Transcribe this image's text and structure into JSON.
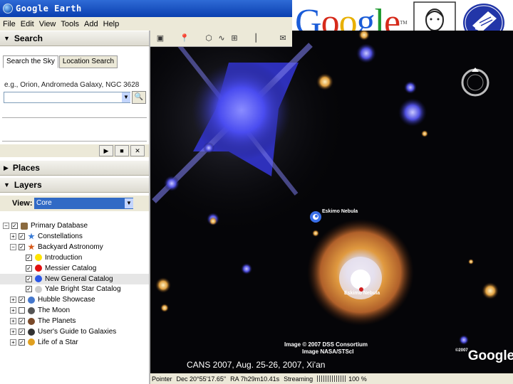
{
  "window": {
    "title": "Google Earth"
  },
  "menu": [
    "File",
    "Edit",
    "View",
    "Tools",
    "Add",
    "Help"
  ],
  "logos": {
    "google": "Google",
    "tm": "TM"
  },
  "search_panel": {
    "header": "Search",
    "tabs": [
      "Search the Sky",
      "Location Search"
    ],
    "hint": "e.g., Orion, Andromeda Galaxy, NGC 3628",
    "input_value": "",
    "controls": [
      "▶",
      "■",
      "✕"
    ]
  },
  "places_panel": {
    "header": "Places"
  },
  "layers_panel": {
    "header": "Layers",
    "view_label": "View:",
    "view_value": "Core",
    "tree": [
      {
        "label": "Primary Database",
        "depth": 0,
        "icon": "database-icon",
        "color": "#8b6a3e",
        "checked": true
      },
      {
        "label": "Constellations",
        "depth": 1,
        "icon": "star-icon",
        "color": "#3a7bd5",
        "checked": true
      },
      {
        "label": "Backyard Astronomy",
        "depth": 1,
        "icon": "star-icon",
        "color": "#d65a1a",
        "checked": true
      },
      {
        "label": "Introduction",
        "depth": 2,
        "icon": "dot-icon",
        "color": "#ffe400",
        "checked": true
      },
      {
        "label": "Messier Catalog",
        "depth": 2,
        "icon": "dot-icon",
        "color": "#e01010",
        "checked": true
      },
      {
        "label": "New General Catalog",
        "depth": 2,
        "icon": "dot-icon",
        "color": "#2a56e6",
        "checked": true
      },
      {
        "label": "Yale Bright Star Catalog",
        "depth": 2,
        "icon": "dot-icon",
        "color": "#cccccc",
        "checked": true
      },
      {
        "label": "Hubble Showcase",
        "depth": 1,
        "icon": "hubble-icon",
        "color": "#4477cc",
        "checked": true
      },
      {
        "label": "The Moon",
        "depth": 1,
        "icon": "moon-icon",
        "color": "#555555",
        "checked": false
      },
      {
        "label": "The Planets",
        "depth": 1,
        "icon": "planet-icon",
        "color": "#7a4a2a",
        "checked": true
      },
      {
        "label": "User's Guide to Galaxies",
        "depth": 1,
        "icon": "galaxy-icon",
        "color": "#333333",
        "checked": true
      },
      {
        "label": "Life of a Star",
        "depth": 1,
        "icon": "sun-icon",
        "color": "#e0a020",
        "checked": true
      }
    ]
  },
  "sky_view": {
    "placemark_label": "Eskimo Nebula",
    "nebula_label": "Eskimo Nebula",
    "credits": [
      "Image © 2007 DSS Consortium",
      "Image NASA/STScI"
    ],
    "caption": "CANS 2007, Aug. 25-26, 2007, Xi'an",
    "watermark": "Google",
    "watermark_prefix": "©2007"
  },
  "status": {
    "pointer_label": "Pointer",
    "dec": "Dec 20°55'17.65\"",
    "ra": "RA  7h29m10.41s",
    "streaming_label": "Streaming",
    "streaming_percent": "100 %"
  }
}
